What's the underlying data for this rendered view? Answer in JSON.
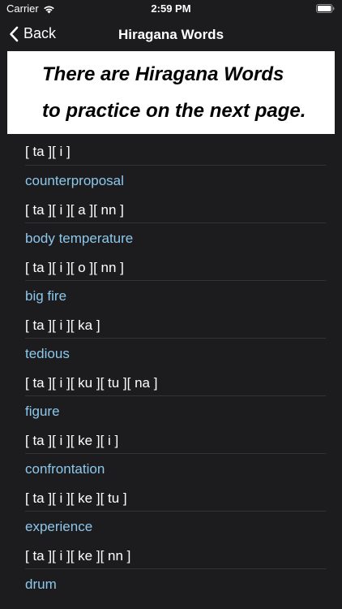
{
  "status_bar": {
    "carrier": "Carrier",
    "time": "2:59 PM"
  },
  "nav": {
    "back_label": "Back",
    "title": "Hiragana Words"
  },
  "banner": {
    "line1": "There are Hiragana Words",
    "line2": "to practice on the next page."
  },
  "list": {
    "first_kana": "[ ta ][ i ]",
    "items": [
      {
        "meaning": "counterproposal",
        "kana": "[ ta ][ i ][ a ][ nn ]"
      },
      {
        "meaning": "body temperature",
        "kana": "[ ta ][ i ][ o ][ nn ]"
      },
      {
        "meaning": "big fire",
        "kana": "[ ta ][ i ][ ka ]"
      },
      {
        "meaning": "tedious",
        "kana": "[ ta ][ i ][ ku ][ tu ][ na ]"
      },
      {
        "meaning": "figure",
        "kana": "[ ta ][ i ][ ke ][ i ]"
      },
      {
        "meaning": "confrontation",
        "kana": "[ ta ][ i ][ ke ][ tu ]"
      },
      {
        "meaning": "experience",
        "kana": "[ ta ][ i ][ ke ][ nn ]"
      },
      {
        "meaning": "drum",
        "kana": ""
      }
    ]
  },
  "colors": {
    "background": "#1c1c1e",
    "meaning_text": "#8cc8ec",
    "banner_bg": "#ffffff"
  },
  "icons": [
    "wifi-icon",
    "battery-icon",
    "chevron-left-icon"
  ]
}
